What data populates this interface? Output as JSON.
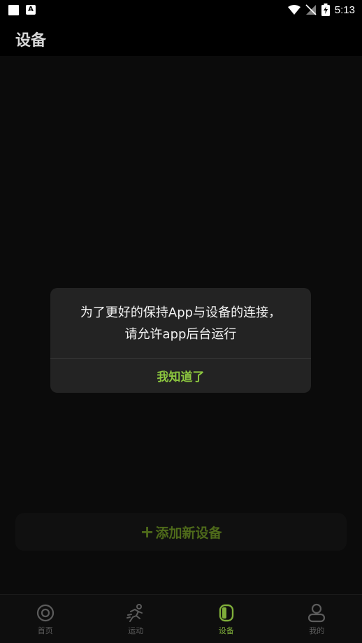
{
  "status_bar": {
    "time": "5:13"
  },
  "header": {
    "title": "设备"
  },
  "main": {
    "add_device_label": "添加新设备",
    "add_device_plus": "+"
  },
  "dialog": {
    "message_line1": "为了更好的保持App与设备的连接，",
    "message_line2": "请允许app后台运行",
    "confirm_label": "我知道了",
    "accent_color": "#8cc63f"
  },
  "tabs": [
    {
      "label": "首页",
      "icon": "target-icon"
    },
    {
      "label": "运动",
      "icon": "runner-icon"
    },
    {
      "label": "设备",
      "icon": "watch-icon",
      "active": true
    },
    {
      "label": "我的",
      "icon": "person-icon"
    }
  ]
}
